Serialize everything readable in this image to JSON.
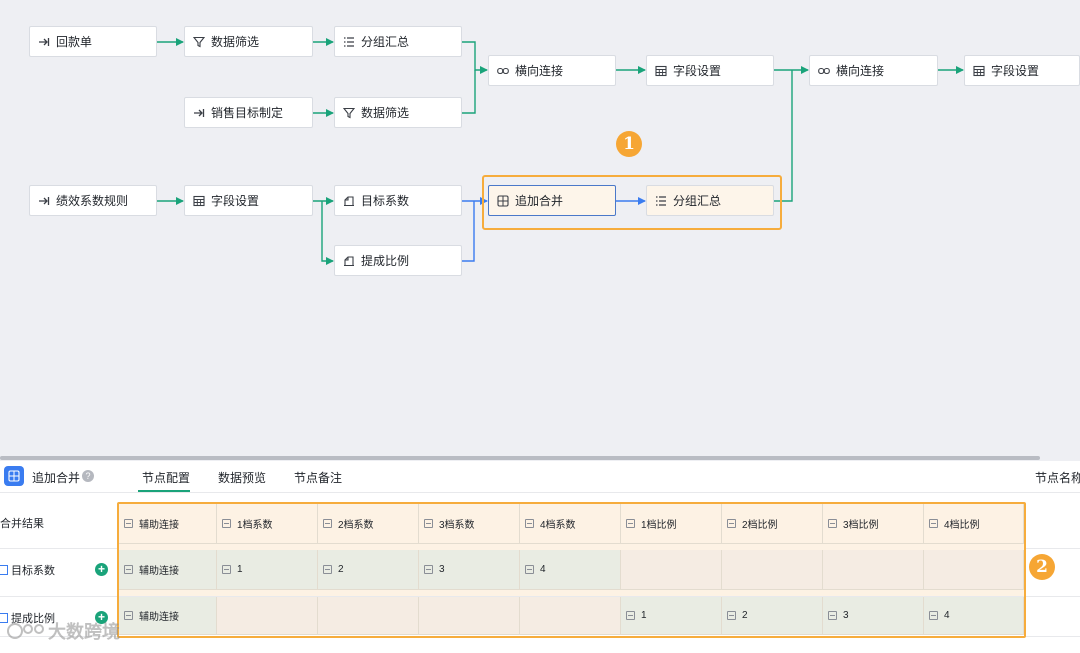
{
  "canvas": {
    "nodes": {
      "n1": {
        "label": "回款单",
        "icon": "input-icon"
      },
      "n2": {
        "label": "数据筛选",
        "icon": "filter-icon"
      },
      "n3": {
        "label": "分组汇总",
        "icon": "list-icon"
      },
      "n4": {
        "label": "横向连接",
        "icon": "link-icon"
      },
      "n5": {
        "label": "字段设置",
        "icon": "table-icon"
      },
      "n6": {
        "label": "横向连接",
        "icon": "link-icon"
      },
      "n7": {
        "label": "字段设置",
        "icon": "table-icon"
      },
      "n8": {
        "label": "销售目标制定",
        "icon": "input-icon"
      },
      "n9": {
        "label": "数据筛选",
        "icon": "filter-icon"
      },
      "n10": {
        "label": "绩效系数规则",
        "icon": "input-icon"
      },
      "n11": {
        "label": "字段设置",
        "icon": "table-icon"
      },
      "n12": {
        "label": "目标系数",
        "icon": "calc-icon"
      },
      "n13": {
        "label": "追加合并",
        "icon": "append-icon"
      },
      "n14": {
        "label": "分组汇总",
        "icon": "list-icon"
      },
      "n15": {
        "label": "提成比例",
        "icon": "calc-icon"
      }
    },
    "markers": {
      "m1": "1",
      "m2": "2"
    },
    "colors": {
      "edge_green": "#1aa37a",
      "edge_blue": "#3a7cf0",
      "highlight": "#f6ac3c"
    }
  },
  "panel": {
    "title": "追加合并",
    "help": "?",
    "tabs": [
      "节点配置",
      "数据预览",
      "节点备注"
    ],
    "active_tab": "节点配置",
    "node_name_label": "节点名称",
    "rows": [
      {
        "label": "合并结果"
      },
      {
        "label": "目标系数",
        "add": "+"
      },
      {
        "label": "提成比例",
        "add": "+"
      }
    ],
    "columns": [
      "辅助连接",
      "1档系数",
      "2档系数",
      "3档系数",
      "4档系数",
      "1档比例",
      "2档比例",
      "3档比例",
      "4档比例"
    ],
    "table": [
      [
        "辅助连接",
        "1",
        "2",
        "3",
        "4",
        "",
        "",
        "",
        ""
      ],
      [
        "辅助连接",
        "",
        "",
        "",
        "",
        "1",
        "2",
        "3",
        "4"
      ]
    ]
  },
  "watermark": "大数跨境"
}
